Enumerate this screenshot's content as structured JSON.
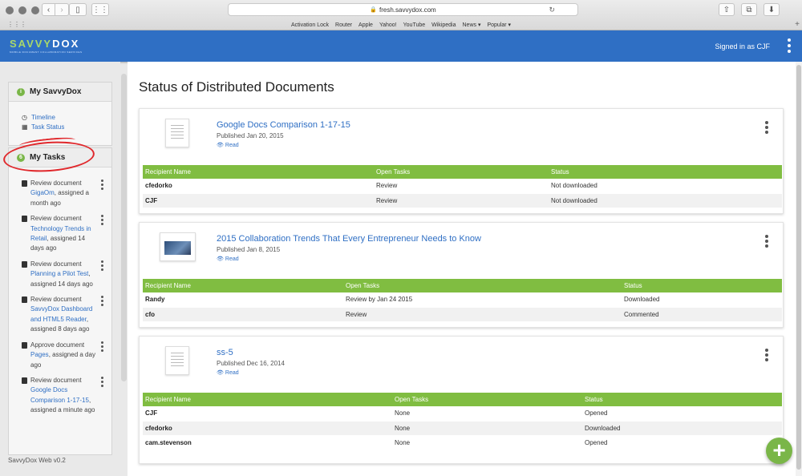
{
  "browser": {
    "url": "fresh.savvydox.com",
    "bookmarks": [
      "Activation Lock",
      "Router",
      "Apple",
      "Yahoo!",
      "YouTube",
      "Wikipedia",
      "News ▾",
      "Popular ▾"
    ]
  },
  "header": {
    "logo_left": "SAVVY",
    "logo_right": "DOX",
    "logo_tagline": "MOBILE DOCUMENT COLLABORATION SERVICES",
    "signed_in": "Signed in as CJF"
  },
  "sidebar": {
    "my_savvydox": {
      "title": "My SavvyDox",
      "badge": "i",
      "links": [
        "Timeline",
        "Task Status"
      ]
    },
    "my_tasks": {
      "title": "My Tasks",
      "badge": "6",
      "tasks": [
        {
          "pre": "Review document ",
          "link": "GigaOm",
          "post": ", assigned a month ago"
        },
        {
          "pre": "Review document ",
          "link": "Technology Trends in Retail",
          "post": ", assigned 14 days ago"
        },
        {
          "pre": "Review document ",
          "link": "Planning a Pilot Test",
          "post": ", assigned 14 days ago"
        },
        {
          "pre": "Review document ",
          "link": "SavvyDox Dashboard and HTML5 Reader",
          "post": ", assigned 8 days ago"
        },
        {
          "pre": "Approve document ",
          "link": "Pages",
          "post": ", assigned a day ago"
        },
        {
          "pre": "Review document ",
          "link": "Google Docs Comparison 1-17-15",
          "post": ", assigned a minute ago"
        }
      ]
    },
    "version": "SavvyDox Web v0.2"
  },
  "main": {
    "page_title": "Status of Distributed Documents",
    "documents": [
      {
        "title": "Google Docs Comparison 1-17-15",
        "published": "Published Jan 20, 2015",
        "read": "Read",
        "columns": [
          "Recipient Name",
          "Open Tasks",
          "Status"
        ],
        "rows": [
          [
            "cfedorko",
            "Review",
            "Not downloaded"
          ],
          [
            "CJF",
            "Review",
            "Not downloaded"
          ]
        ]
      },
      {
        "title": "2015 Collaboration Trends That Every Entrepreneur Needs to Know",
        "published": "Published Jan 8, 2015",
        "read": "Read",
        "columns": [
          "Recipient Name",
          "Open Tasks",
          "Status"
        ],
        "rows": [
          [
            "Randy",
            "Review by Jan 24 2015",
            "Downloaded"
          ],
          [
            "cfo",
            "Review",
            "Commented"
          ]
        ]
      },
      {
        "title": "ss-5",
        "published": "Published Dec 16, 2014",
        "read": "Read",
        "columns": [
          "Recipient Name",
          "Open Tasks",
          "Status"
        ],
        "rows": [
          [
            "CJF",
            "None",
            "Opened"
          ],
          [
            "cfedorko",
            "None",
            "Downloaded"
          ],
          [
            "cam.stevenson",
            "None",
            "Opened"
          ]
        ]
      }
    ]
  },
  "fab_label": "+",
  "colors": {
    "brand_blue": "#2f6fc4",
    "accent_green": "#80bd41",
    "annotation_red": "#e0282c"
  }
}
